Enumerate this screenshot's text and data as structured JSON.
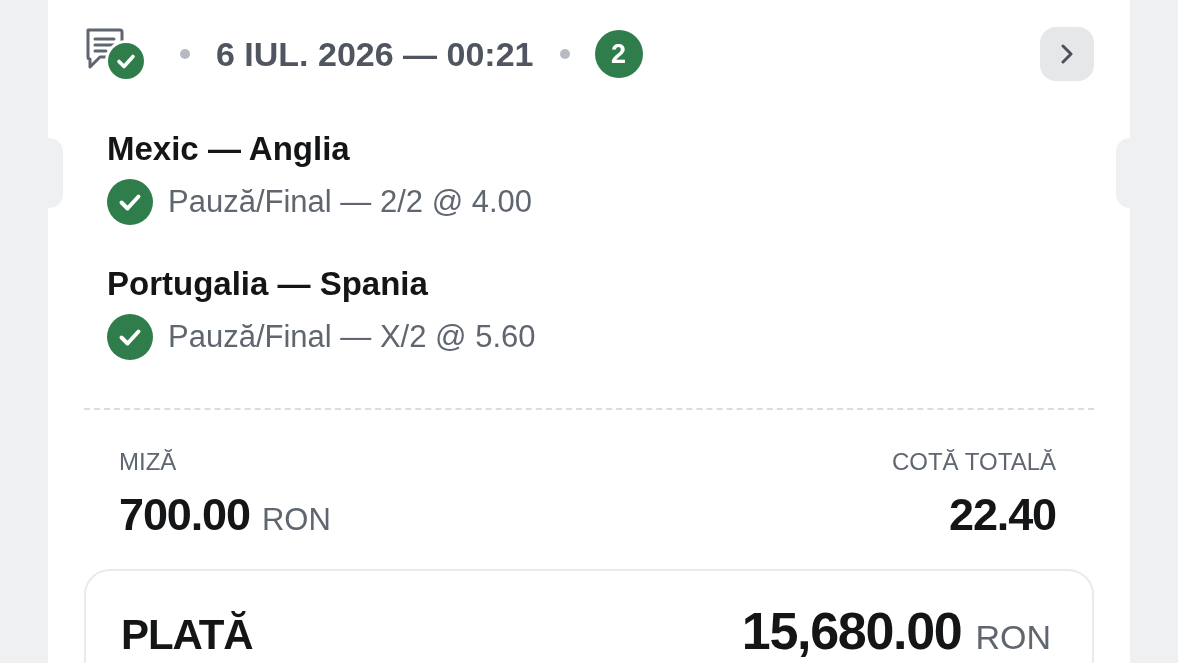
{
  "bet_card": {
    "header": {
      "won": true,
      "date_time": "6 IUL. 2026 — 00:21",
      "selections_count": "2"
    },
    "selections": [
      {
        "match": "Mexic — Anglia",
        "market": "Pauză/Final — 2/2 @ 4.00",
        "won": true
      },
      {
        "match": "Portugalia — Spania",
        "market": "Pauză/Final — X/2 @ 5.60",
        "won": true
      }
    ],
    "stake": {
      "label": "MIZĂ",
      "amount": "700.00",
      "currency": "RON"
    },
    "total_odds": {
      "label": "COTĂ TOTALĂ",
      "value": "22.40"
    },
    "payout": {
      "label": "PLATĂ",
      "amount": "15,680.00",
      "currency": "RON"
    }
  }
}
